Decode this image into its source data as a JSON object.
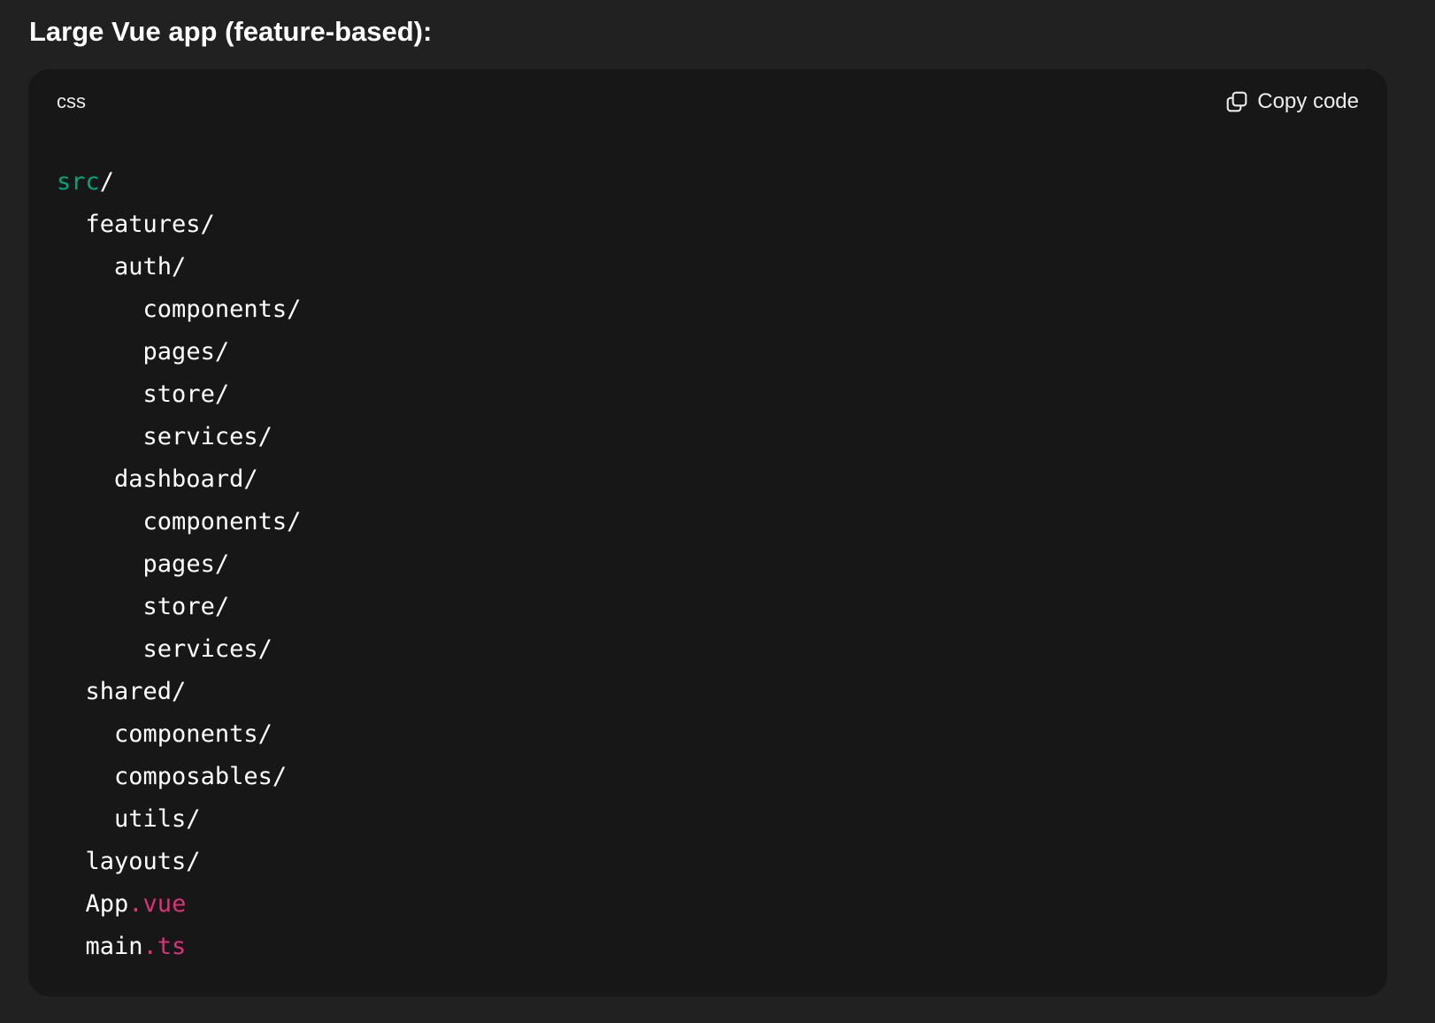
{
  "heading": "Large Vue app (feature-based):",
  "code_block": {
    "language": "css",
    "copy_label": "Copy code",
    "lines": [
      {
        "indent": "",
        "parts": [
          {
            "text": "src",
            "style": "green"
          },
          {
            "text": "/",
            "style": "plain"
          }
        ]
      },
      {
        "indent": "  ",
        "parts": [
          {
            "text": "features/",
            "style": "plain"
          }
        ]
      },
      {
        "indent": "    ",
        "parts": [
          {
            "text": "auth/",
            "style": "plain"
          }
        ]
      },
      {
        "indent": "      ",
        "parts": [
          {
            "text": "components/",
            "style": "plain"
          }
        ]
      },
      {
        "indent": "      ",
        "parts": [
          {
            "text": "pages/",
            "style": "plain"
          }
        ]
      },
      {
        "indent": "      ",
        "parts": [
          {
            "text": "store/",
            "style": "plain"
          }
        ]
      },
      {
        "indent": "      ",
        "parts": [
          {
            "text": "services/",
            "style": "plain"
          }
        ]
      },
      {
        "indent": "    ",
        "parts": [
          {
            "text": "dashboard/",
            "style": "plain"
          }
        ]
      },
      {
        "indent": "      ",
        "parts": [
          {
            "text": "components/",
            "style": "plain"
          }
        ]
      },
      {
        "indent": "      ",
        "parts": [
          {
            "text": "pages/",
            "style": "plain"
          }
        ]
      },
      {
        "indent": "      ",
        "parts": [
          {
            "text": "store/",
            "style": "plain"
          }
        ]
      },
      {
        "indent": "      ",
        "parts": [
          {
            "text": "services/",
            "style": "plain"
          }
        ]
      },
      {
        "indent": "  ",
        "parts": [
          {
            "text": "shared/",
            "style": "plain"
          }
        ]
      },
      {
        "indent": "    ",
        "parts": [
          {
            "text": "components/",
            "style": "plain"
          }
        ]
      },
      {
        "indent": "    ",
        "parts": [
          {
            "text": "composables/",
            "style": "plain"
          }
        ]
      },
      {
        "indent": "    ",
        "parts": [
          {
            "text": "utils/",
            "style": "plain"
          }
        ]
      },
      {
        "indent": "  ",
        "parts": [
          {
            "text": "layouts/",
            "style": "plain"
          }
        ]
      },
      {
        "indent": "  ",
        "parts": [
          {
            "text": "App",
            "style": "plain"
          },
          {
            "text": ".vue",
            "style": "pink"
          }
        ]
      },
      {
        "indent": "  ",
        "parts": [
          {
            "text": "main",
            "style": "plain"
          },
          {
            "text": ".ts",
            "style": "pink"
          }
        ]
      }
    ]
  },
  "icons": {
    "copy": "copy-icon"
  },
  "colors": {
    "page_bg": "#212121",
    "code_bg": "#171717",
    "token_green": "#00a67d",
    "token_pink": "#df3079"
  }
}
